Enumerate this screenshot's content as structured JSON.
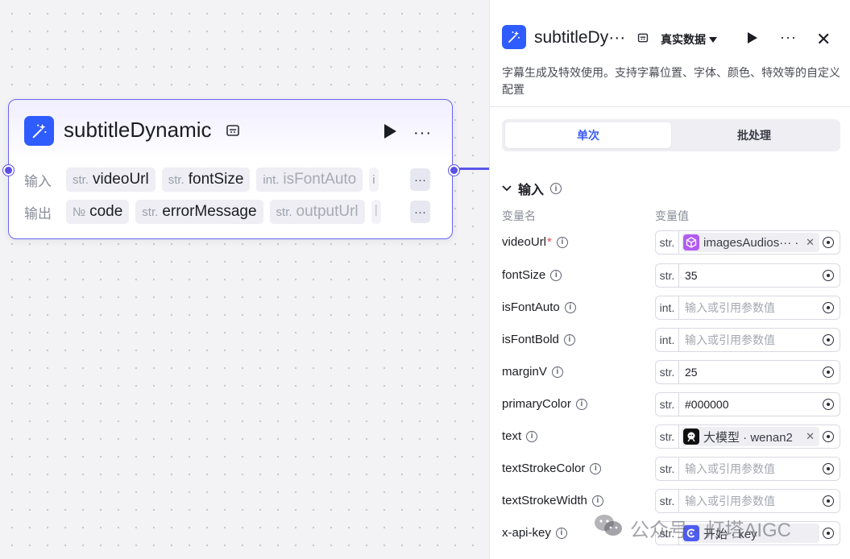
{
  "node": {
    "title": "subtitleDynamic",
    "input_label": "输入",
    "output_label": "输出",
    "inputs": [
      {
        "type": "str.",
        "name": "videoUrl"
      },
      {
        "type": "str.",
        "name": "fontSize"
      },
      {
        "type": "int.",
        "name": "isFontAuto"
      },
      {
        "type": "i",
        "name": ""
      }
    ],
    "outputs": [
      {
        "type": "№",
        "name": "code"
      },
      {
        "type": "str.",
        "name": "errorMessage"
      },
      {
        "type": "str.",
        "name": "outputUrl"
      },
      {
        "type": "",
        "name": "l"
      }
    ],
    "more": "···"
  },
  "panel": {
    "title": "subtitleDy···",
    "mode": "真实数据",
    "more": "···",
    "close": "✕",
    "description": "字幕生成及特效使用。支持字幕位置、字体、颜色、特效等的自定义配置",
    "tabs": [
      "单次",
      "批处理"
    ],
    "section_title": "输入",
    "col_name": "变量名",
    "col_value": "变量值",
    "params": [
      {
        "name": "videoUrl",
        "required": true,
        "type": "str.",
        "ref": "imagesAudios··· ·",
        "ref_icon": "cube-icon",
        "ref_color": "#b05cf0"
      },
      {
        "name": "fontSize",
        "type": "str.",
        "value": "35"
      },
      {
        "name": "isFontAuto",
        "type": "int.",
        "placeholder": "输入或引用参数值"
      },
      {
        "name": "isFontBold",
        "type": "int.",
        "placeholder": "输入或引用参数值"
      },
      {
        "name": "marginV",
        "type": "str.",
        "value": "25"
      },
      {
        "name": "primaryColor",
        "type": "str.",
        "value": "#000000"
      },
      {
        "name": "text",
        "type": "str.",
        "ref": "大模型 · wenan2",
        "ref_icon": "llm-icon",
        "ref_color": "#111111"
      },
      {
        "name": "textStrokeColor",
        "type": "str.",
        "placeholder": "输入或引用参数值"
      },
      {
        "name": "textStrokeWidth",
        "type": "str.",
        "placeholder": "输入或引用参数值"
      },
      {
        "name": "x-api-key",
        "type": "str.",
        "ref": "开始 · key",
        "ref_icon": "start-icon",
        "ref_color": "#4f5cf0"
      }
    ]
  },
  "watermark": "公众号 · 灯塔AIGC",
  "colors": {
    "accent": "#2f5cff",
    "edge": "#5a56e8",
    "required": "#e5484d"
  }
}
